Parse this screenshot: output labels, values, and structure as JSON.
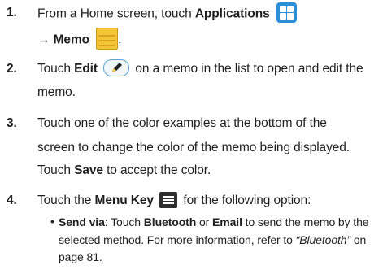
{
  "steps": [
    {
      "num": "1.",
      "line1": {
        "pre": "From a Home screen, touch ",
        "bold": "Applications"
      },
      "line2": {
        "arrow": "→ ",
        "bold": "Memo",
        "post": "."
      }
    },
    {
      "num": "2.",
      "line1": {
        "pre": "Touch ",
        "bold": "Edit",
        "post": " on a memo in the list to open and edit the"
      },
      "line2": "memo."
    },
    {
      "num": "3.",
      "line1": "Touch one of the color examples at the bottom of the",
      "line2": "screen to change the color of the memo being displayed.",
      "line3": {
        "pre": "Touch ",
        "bold": "Save",
        "post": " to accept the color."
      }
    },
    {
      "num": "4.",
      "line1": {
        "pre": "Touch the ",
        "bold": "Menu Key",
        "post": " for the following option:"
      }
    }
  ],
  "bullet": {
    "line1": {
      "label": "Send via",
      "pre": ": Touch ",
      "b1": "Bluetooth",
      "mid": " or ",
      "b2": "Email",
      "post": " to send the memo by the"
    },
    "line2": {
      "pre": "selected method. For more information, refer to ",
      "ref": "“Bluetooth”",
      "post": " on"
    },
    "line3": "page 81."
  },
  "icons": {
    "applications": "applications-grid-icon",
    "memo": "memo-note-icon",
    "edit": "edit-pencil-icon",
    "menu": "menu-key-icon"
  },
  "colors": {
    "apps_blue": "#2a8fd6",
    "memo_yellow": "#f4c636",
    "edit_border": "#58a5d8"
  }
}
